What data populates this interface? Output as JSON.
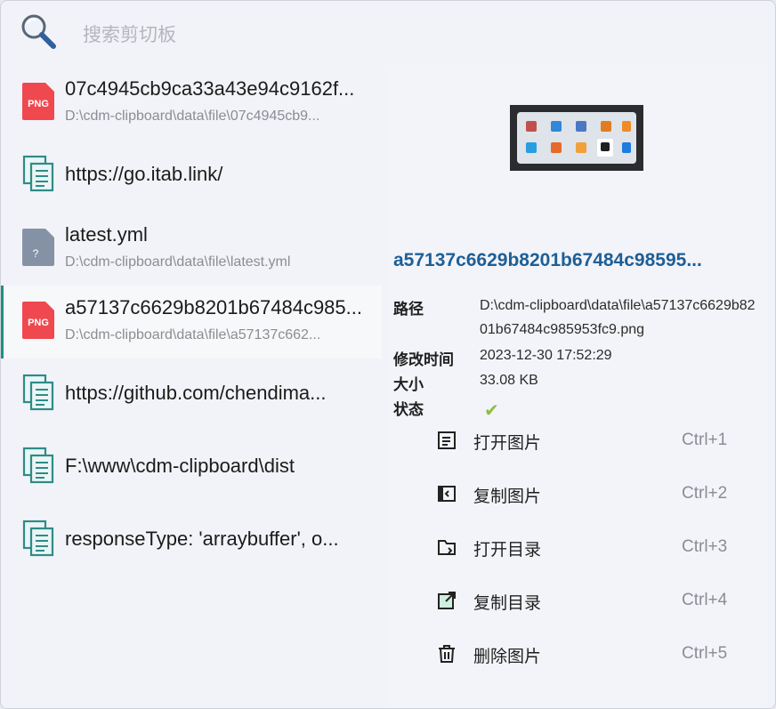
{
  "search": {
    "placeholder": "搜索剪切板",
    "value": ""
  },
  "items": [
    {
      "type": "png",
      "badge": "PNG",
      "title": "07c4945cb9ca33a43e94c9162f...",
      "sub": "D:\\cdm-clipboard\\data\\file\\07c4945cb9..."
    },
    {
      "type": "text",
      "title": "https://go.itab.link/"
    },
    {
      "type": "unknown",
      "badge": "?",
      "title": "latest.yml",
      "sub": "D:\\cdm-clipboard\\data\\file\\latest.yml"
    },
    {
      "type": "png",
      "badge": "PNG",
      "title": "a57137c6629b8201b67484c985...",
      "sub": "D:\\cdm-clipboard\\data\\file\\a57137c662...",
      "selected": true
    },
    {
      "type": "text",
      "title": "https://github.com/chendima..."
    },
    {
      "type": "text",
      "title": "F:\\www\\cdm-clipboard\\dist"
    },
    {
      "type": "text",
      "title": "responseType: 'arraybuffer', o..."
    }
  ],
  "detail": {
    "file_name": "a57137c6629b8201b67484c98595...",
    "path_label": "路径",
    "path_value": "D:\\cdm-clipboard\\data\\file\\a57137c6629b8201b67484c985953fc9.png",
    "modified_label": "修改时间",
    "modified_value": "2023-12-30 17:52:29",
    "size_label": "大小",
    "size_value": "33.08 KB",
    "status_label": "状态",
    "status_value": "✔"
  },
  "actions": [
    {
      "label": "打开图片",
      "shortcut": "Ctrl+1",
      "icon": "open-image-icon"
    },
    {
      "label": "复制图片",
      "shortcut": "Ctrl+2",
      "icon": "copy-image-icon"
    },
    {
      "label": "打开目录",
      "shortcut": "Ctrl+3",
      "icon": "open-folder-icon"
    },
    {
      "label": "复制目录",
      "shortcut": "Ctrl+4",
      "icon": "copy-path-icon"
    },
    {
      "label": "删除图片",
      "shortcut": "Ctrl+5",
      "icon": "trash-icon"
    }
  ],
  "colors": {
    "accent": "#1f8f86",
    "file_name": "#1d5f96",
    "png_badge": "#f0484f",
    "status_ok": "#8cbf3f"
  }
}
